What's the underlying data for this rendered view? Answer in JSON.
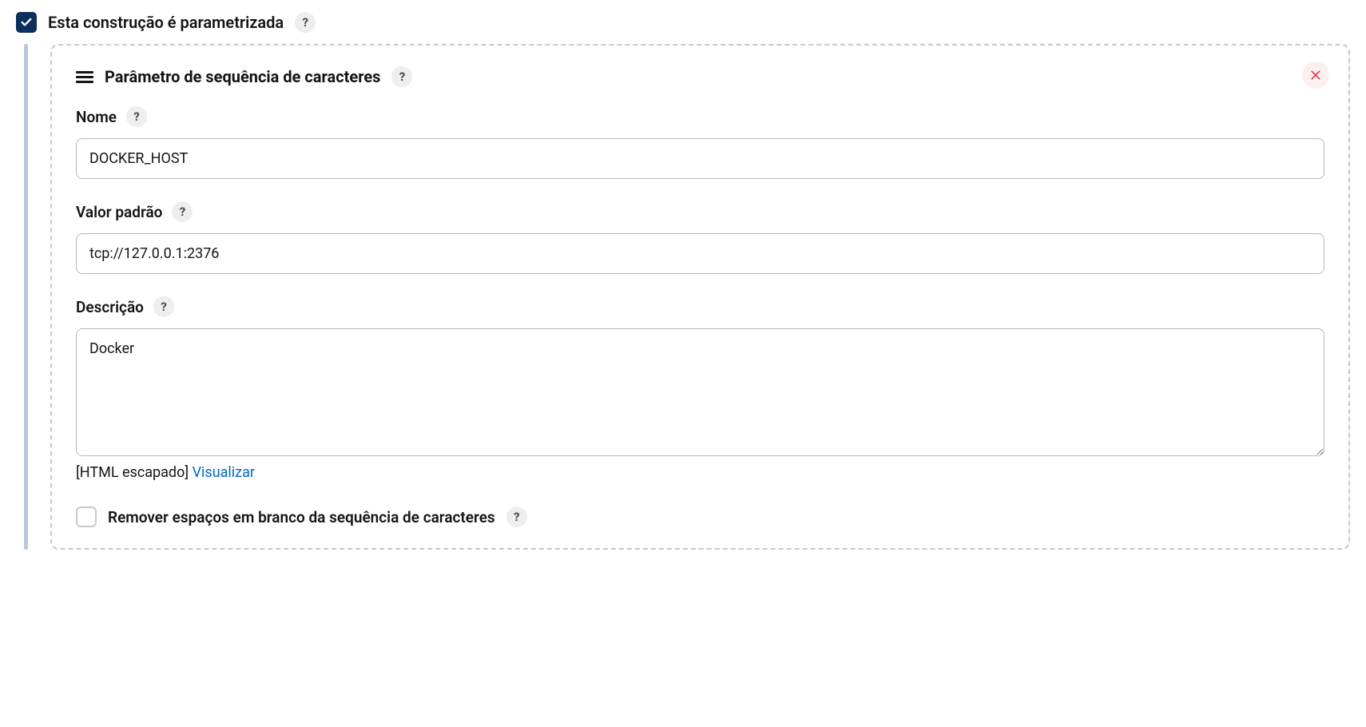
{
  "header": {
    "label": "Esta construção é parametrizada"
  },
  "parameter": {
    "title": "Parâmetro de sequência de caracteres",
    "name": {
      "label": "Nome",
      "value": "DOCKER_HOST"
    },
    "default_value": {
      "label": "Valor padrão",
      "value": "tcp://127.0.0.1:2376"
    },
    "description": {
      "label": "Descrição",
      "value": "Docker",
      "footer_text": "[HTML escapado] ",
      "preview_link": "Visualizar"
    },
    "trim_checkbox": {
      "label": "Remover espaços em branco da sequência de caracteres"
    }
  }
}
